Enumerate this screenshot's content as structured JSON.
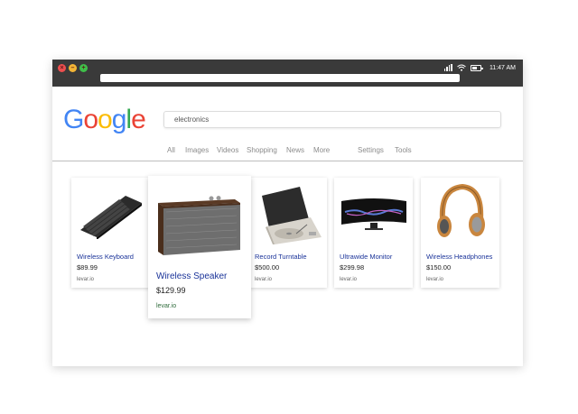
{
  "status_bar": {
    "time": "11:47 AM"
  },
  "logo": {
    "letters": [
      "G",
      "o",
      "o",
      "g",
      "l",
      "e"
    ],
    "colors": [
      "#4285F4",
      "#EA4335",
      "#FBBC05",
      "#4285F4",
      "#34A853",
      "#EA4335"
    ]
  },
  "search": {
    "value": "electronics"
  },
  "nav": {
    "all": "All",
    "images": "Images",
    "videos": "Videos",
    "shopping": "Shopping",
    "news": "News",
    "more": "More",
    "settings": "Settings",
    "tools": "Tools"
  },
  "products": [
    {
      "title": "Wireless Keyboard",
      "price": "$89.99",
      "source": "levar.io",
      "icon": "keyboard-image"
    },
    {
      "title": "Wireless Speaker",
      "price": "$129.99",
      "source": "levar.io",
      "icon": "speaker-image"
    },
    {
      "title": "Record Turntable",
      "price": "$500.00",
      "source": "levar.io",
      "icon": "turntable-image"
    },
    {
      "title": "Ultrawide Monitor",
      "price": "$299.98",
      "source": "levar.io",
      "icon": "monitor-image"
    },
    {
      "title": "Wireless Headphones",
      "price": "$150.00",
      "source": "levar.io",
      "icon": "headphones-image"
    }
  ]
}
